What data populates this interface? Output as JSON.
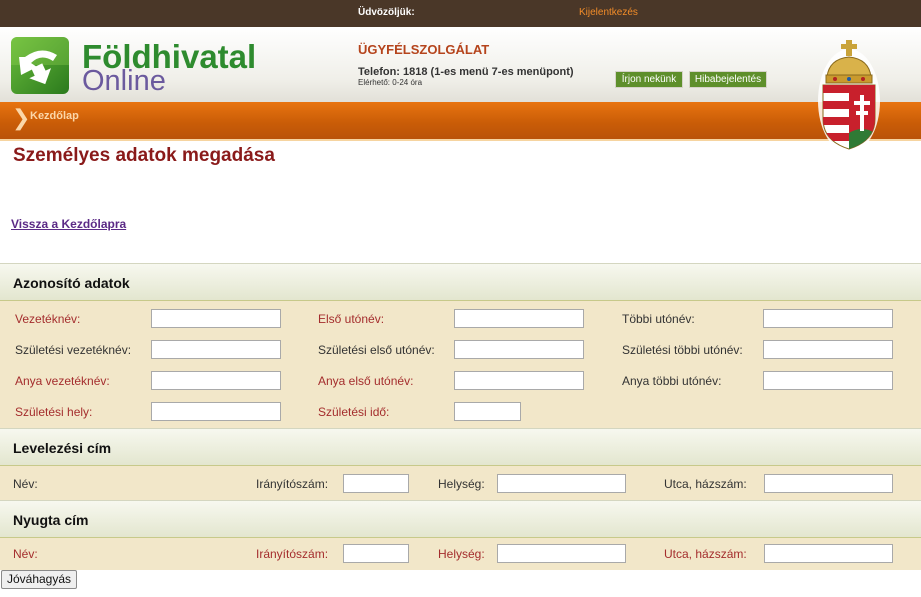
{
  "topbar": {
    "welcome": "Üdvözöljük:",
    "logout": "Kijelentkezés"
  },
  "brand": {
    "main": "Földhivatal",
    "sub": "Online"
  },
  "service": {
    "title": "ÜGYFÉLSZOLGÁLAT",
    "phone": "Telefon: 1818 (1-es menü 7-es menüpont)",
    "hours": "Elérhető: 0-24 óra",
    "write_btn": "Írjon nekünk",
    "bug_btn": "Hibabejelentés"
  },
  "breadcrumb": {
    "home": "Kezdőlap"
  },
  "page": {
    "title": "Személyes adatok megadása",
    "back_link": "Vissza a Kezdőlapra"
  },
  "identity": {
    "title": "Azonosító adatok",
    "fields": {
      "surname": "Vezetéknév:",
      "first_name": "Első utónév:",
      "other_names": "Többi utónév:",
      "birth_surname": "Születési vezetéknév:",
      "birth_first_name": "Születési első utónév:",
      "birth_other_names": "Születési többi utónév:",
      "mother_surname": "Anya vezetéknév:",
      "mother_first_name": "Anya első utónév:",
      "mother_other_names": "Anya többi utónév:",
      "birth_place": "Születési hely:",
      "birth_date": "Születési idő:"
    }
  },
  "mailing": {
    "title": "Levelezési cím",
    "fields": {
      "name": "Név:",
      "zip": "Irányítószám:",
      "city": "Helység:",
      "street": "Utca, házszám:"
    }
  },
  "receipt": {
    "title": "Nyugta cím",
    "fields": {
      "name": "Név:",
      "zip": "Irányítószám:",
      "city": "Helység:",
      "street": "Utca, házszám:"
    }
  },
  "submit": "Jóváhagyás",
  "colors": {
    "topbar": "#4a3728",
    "orange": "#d8660c",
    "required": "#a42d2d",
    "form_bg": "#f2e7c9",
    "title": "#8a1a1a"
  }
}
